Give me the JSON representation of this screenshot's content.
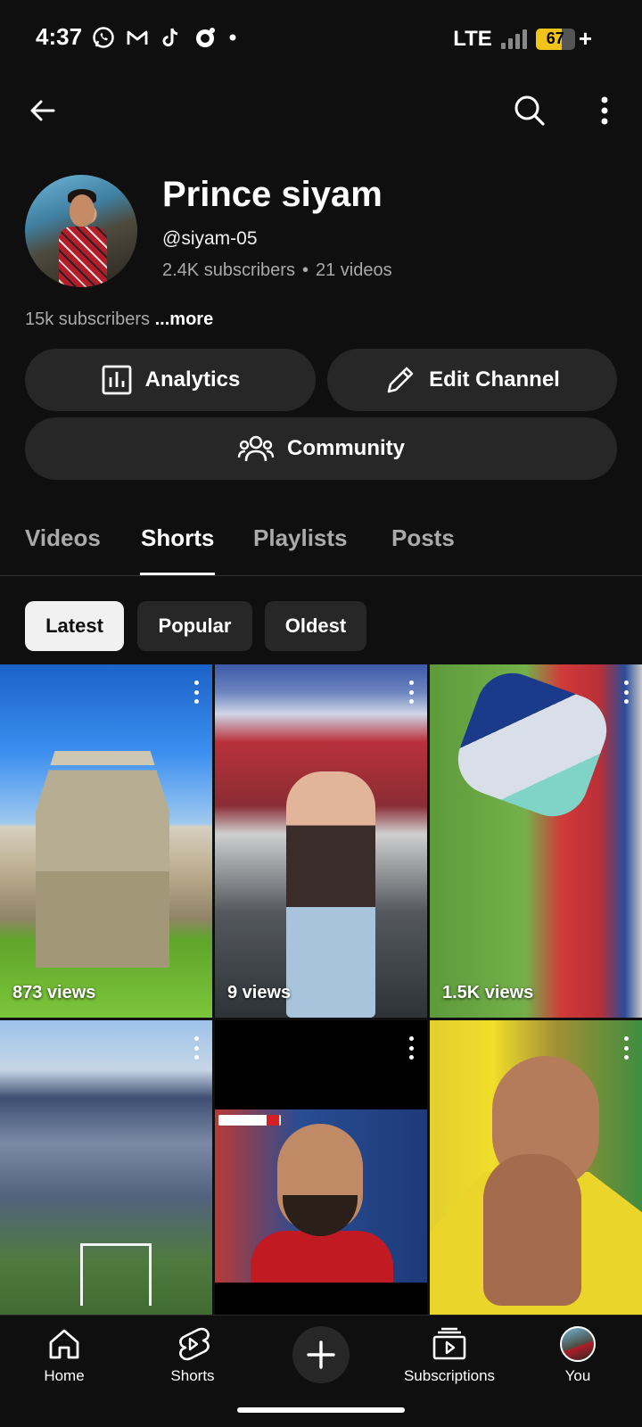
{
  "status_bar": {
    "time": "4:37",
    "network": "LTE",
    "battery_percent": "67",
    "battery_level": 0.67,
    "charging_symbol": "+",
    "notification_icons": [
      "whatsapp-icon",
      "gmail-icon",
      "tiktok-icon",
      "app-notification-icon",
      "dot-icon"
    ]
  },
  "app_bar": {
    "back_icon": "back-arrow-icon",
    "search_icon": "search-icon",
    "more_icon": "more-vert-icon"
  },
  "channel": {
    "name": "Prince siyam",
    "handle": "@siyam-05",
    "subscribers": "2.4K subscribers",
    "separator": "•",
    "videos": "21 videos",
    "description": "15k subscribers",
    "more_label": "...more"
  },
  "actions": {
    "analytics_label": "Analytics",
    "edit_channel_label": "Edit Channel",
    "community_label": "Community"
  },
  "tabs": [
    {
      "label": "Videos",
      "active": false
    },
    {
      "label": "Shorts",
      "active": true
    },
    {
      "label": "Playlists",
      "active": false
    },
    {
      "label": "Posts",
      "active": false
    }
  ],
  "sort_chips": [
    {
      "label": "Latest",
      "selected": true
    },
    {
      "label": "Popular",
      "selected": false
    },
    {
      "label": "Oldest",
      "selected": false
    }
  ],
  "shorts": [
    {
      "views": "873 views"
    },
    {
      "views": "9 views"
    },
    {
      "views": "1.5K views"
    },
    {
      "views": ""
    },
    {
      "views": ""
    },
    {
      "views": ""
    }
  ],
  "bottom_nav": [
    {
      "label": "Home",
      "icon": "home-icon"
    },
    {
      "label": "Shorts",
      "icon": "shorts-icon"
    },
    {
      "label": "",
      "icon": "create-plus-icon"
    },
    {
      "label": "Subscriptions",
      "icon": "subscriptions-icon"
    },
    {
      "label": "You",
      "icon": "avatar"
    }
  ],
  "colors": {
    "background": "#0f0f0f",
    "surface": "#272727",
    "secondary_text": "#aaaaaa",
    "battery": "#f0c419"
  }
}
